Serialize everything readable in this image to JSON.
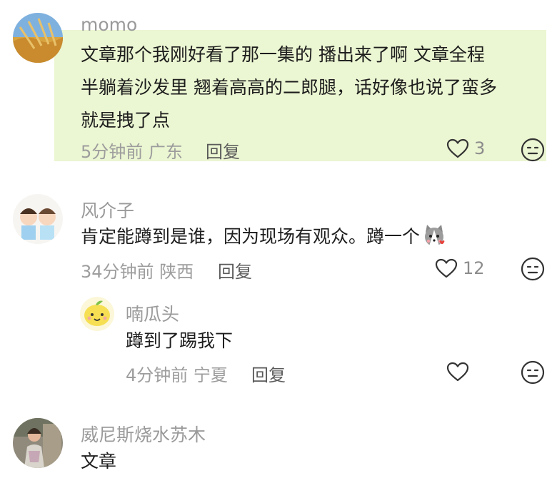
{
  "comments": [
    {
      "author": "momo",
      "lines": [
        "文章那个我刚好看了那一集的 播出来了啊 文章全程",
        "半躺着沙发里 翘着高高的二郎腿，话好像也说了蛮多",
        "就是拽了点"
      ],
      "time": "5分钟前",
      "location": "广东",
      "reply_label": "回复",
      "likes": "3",
      "avatar_icon": "wheat-field-avatar",
      "highlight_color": "#ebf6d2"
    },
    {
      "author": "风介子",
      "text": "肯定能蹲到是谁，因为现场有观众。蹲一个",
      "sticker": "husky-heart-sticker",
      "time": "34分钟前",
      "location": "陕西",
      "reply_label": "回复",
      "likes": "12",
      "avatar_icon": "cartoon-couple-avatar"
    },
    {
      "author": "喃瓜头",
      "text": "蹲到了踢我下",
      "time": "4分钟前",
      "location": "宁夏",
      "reply_label": "回复",
      "avatar_icon": "lemon-character-avatar"
    },
    {
      "author": "威尼斯烧水苏木",
      "text": "文章",
      "avatar_icon": "woman-photo-avatar"
    }
  ],
  "icons": {
    "like": "heart-outline-icon",
    "reaction": "face-reaction-icon"
  }
}
